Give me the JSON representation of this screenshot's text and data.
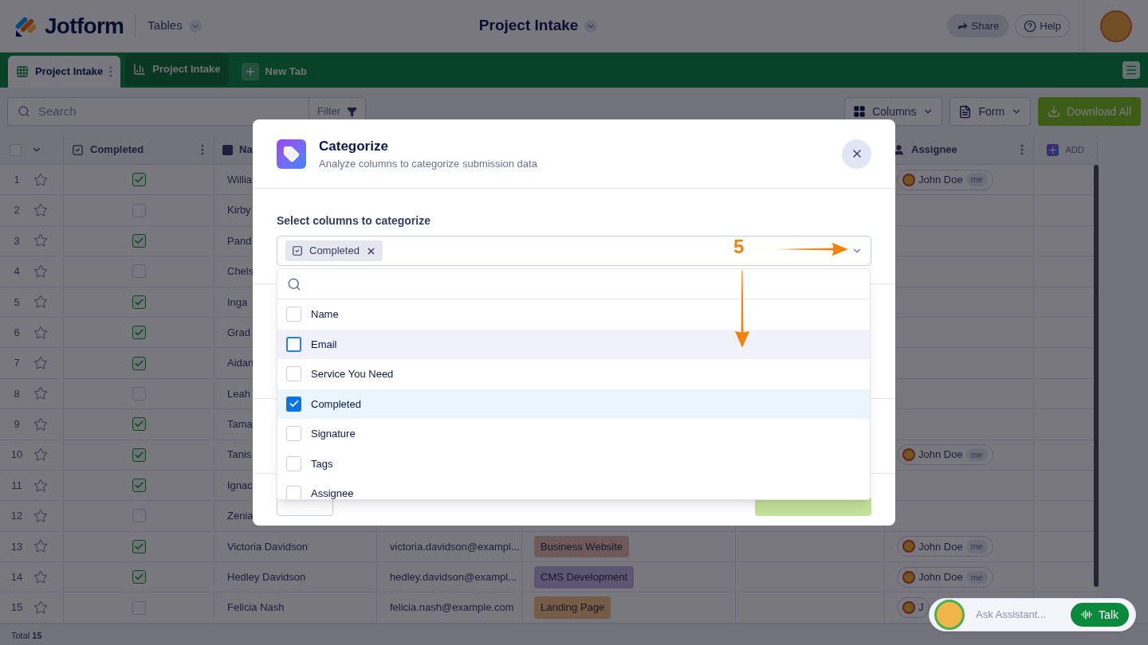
{
  "header": {
    "logo": "Jotform",
    "app_menu": "Tables",
    "title": "Project Intake",
    "share": "Share",
    "help": "Help"
  },
  "tabs": [
    {
      "label": "Project Intake",
      "kind": "table",
      "selected": true
    },
    {
      "label": "Project Intake",
      "kind": "report",
      "selected": false
    },
    {
      "label": "New Tab",
      "kind": "add",
      "selected": false
    }
  ],
  "toolbar": {
    "search_placeholder": "Search",
    "filter": "Filter",
    "columns": "Columns",
    "form": "Form",
    "download": "Download All"
  },
  "table": {
    "select_all": {
      "checked": false
    },
    "header": {
      "completed": "Completed",
      "name": "Na",
      "assignee": "Assignee",
      "add": "ADD"
    },
    "rows": [
      {
        "number": "1",
        "starred": false,
        "completed": true,
        "name": "Willia",
        "assignee": {
          "name": "John Doe",
          "badge": "me"
        }
      },
      {
        "number": "2",
        "starred": false,
        "completed": false,
        "name": "Kirby"
      },
      {
        "number": "3",
        "starred": false,
        "completed": true,
        "name": "Pand"
      },
      {
        "number": "4",
        "starred": false,
        "completed": false,
        "name": "Chels"
      },
      {
        "number": "5",
        "starred": false,
        "completed": true,
        "name": "Inga"
      },
      {
        "number": "6",
        "starred": false,
        "completed": true,
        "name": "Grad"
      },
      {
        "number": "7",
        "starred": false,
        "completed": true,
        "name": "Aidan"
      },
      {
        "number": "8",
        "starred": false,
        "completed": false,
        "name": "Leah"
      },
      {
        "number": "9",
        "starred": false,
        "completed": true,
        "name": "Tama"
      },
      {
        "number": "10",
        "starred": false,
        "completed": true,
        "name": "Tanis",
        "assignee": {
          "name": "John Doe",
          "badge": "me"
        }
      },
      {
        "number": "11",
        "starred": false,
        "completed": true,
        "name": "Ignac"
      },
      {
        "number": "12",
        "starred": false,
        "completed": false,
        "name": "Zenia"
      },
      {
        "number": "13",
        "starred": false,
        "completed": true,
        "name": "Victoria Davidson",
        "email": "victoria.davidson@exampl...",
        "service": {
          "label": "Business Website",
          "color": "#6e5a5a"
        },
        "assignee": {
          "name": "John Doe",
          "badge": "me"
        }
      },
      {
        "number": "14",
        "starred": false,
        "completed": true,
        "name": "Hedley Davidson",
        "email": "hedley.davidson@exampl...",
        "service": {
          "label": "CMS Development",
          "color": "#5d5673"
        },
        "assignee": {
          "name": "John Doe",
          "badge": "me"
        }
      },
      {
        "number": "15",
        "starred": false,
        "completed": false,
        "name": "Felicia Nash",
        "email": "felicia.nash@example.com",
        "service": {
          "label": "Landing Page",
          "color": "#755c46"
        },
        "assignee": {
          "name": "J"
        }
      }
    ],
    "total": "Total **15**"
  },
  "modal": {
    "title": "Categorize",
    "subtitle": "Analyze columns to categorize submission data",
    "field_label": "Select columns to categorize",
    "chips": [
      {
        "label": "Completed"
      }
    ],
    "options": [
      {
        "label": "Name",
        "checked": false,
        "highlighted": false
      },
      {
        "label": "Email",
        "checked": false,
        "highlighted": true
      },
      {
        "label": "Service You Need",
        "checked": false,
        "highlighted": false
      },
      {
        "label": "Completed",
        "checked": true,
        "highlighted": false
      },
      {
        "label": "Signature",
        "checked": false,
        "highlighted": false
      },
      {
        "label": "Tags",
        "checked": false,
        "highlighted": false
      },
      {
        "label": "Assignee",
        "checked": false,
        "highlighted": false
      }
    ]
  },
  "annotation": {
    "label": "5"
  },
  "assistant": {
    "prompt": "Ask Assistant...",
    "talk": "Talk"
  }
}
